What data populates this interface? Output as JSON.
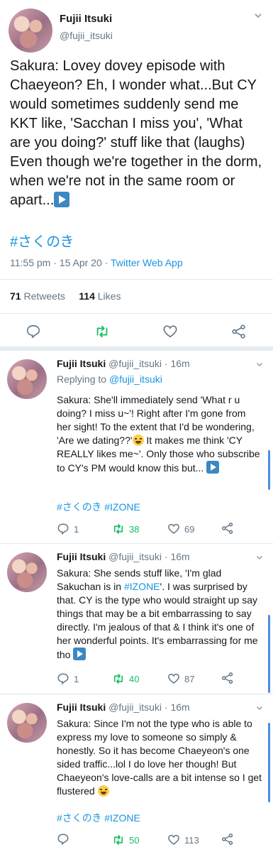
{
  "main_tweet": {
    "name": "Fujii Itsuki",
    "handle": "@fujii_itsuki",
    "text": "Sakura: Lovey dovey episode with Chaeyeon? Eh, I wonder what...But CY would sometimes suddenly send me KKT like, 'Sacchan I miss you', 'What are you doing?' stuff like that (laughs) Even though we're together in the dorm, when we're not in the same room or apart...",
    "hashtag": "#さくのき",
    "time": "11:55 pm",
    "date": "15 Apr 20",
    "source": "Twitter Web App",
    "retweets_count": "71",
    "retweets_label": "Retweets",
    "likes_count": "114",
    "likes_label": "Likes",
    "icons": [
      "reply-icon",
      "retweet-icon",
      "like-icon",
      "share-icon"
    ]
  },
  "replies": [
    {
      "name": "Fujii Itsuki",
      "handle": "@fujii_itsuki",
      "age": "16m",
      "replying_label": "Replying to",
      "replying_to": "@fujii_itsuki",
      "text": "Sakura: She'll immediately send 'What r u doing? I miss u~'! Right after I'm gone from her sight! To the extent that I'd be wondering, 'Are we dating??'",
      "text_after_emoji": " It makes me think 'CY REALLY likes me~'. Only those who subscribe to CY's PM would know this but...",
      "hashtags": "#さくのき #IZONE",
      "replies": "1",
      "retweets": "38",
      "likes": "69"
    },
    {
      "name": "Fujii Itsuki",
      "handle": "@fujii_itsuki",
      "age": "16m",
      "text_before_tag": "Sakura: She sends stuff like, 'I'm glad Sakuchan is in ",
      "inline_tag": "#IZONE",
      "text_after_tag": "'. I was surprised by that. CY is the type who would straight up say things that may be a bit embarrassing to say directly. I'm jealous of that & I think it's one of her wonderful points. It's embarrassing for me tho",
      "replies": "1",
      "retweets": "40",
      "likes": "87"
    },
    {
      "name": "Fujii Itsuki",
      "handle": "@fujii_itsuki",
      "age": "16m",
      "text": "Sakura: Since I'm not the type who is able to express my love to someone so simply & honestly. So it has become Chaeyeon's one sided traffic...lol I do love her though! But Chaeyeon's love-calls are a bit intense so I get flustered",
      "hashtags": "#さくのき #IZONE",
      "retweets": "50",
      "likes": "113"
    }
  ],
  "colors": {
    "link": "#1b95e0",
    "secondary": "#657786",
    "retweet_active": "#17bf63",
    "divider": "#e1e8ed"
  }
}
